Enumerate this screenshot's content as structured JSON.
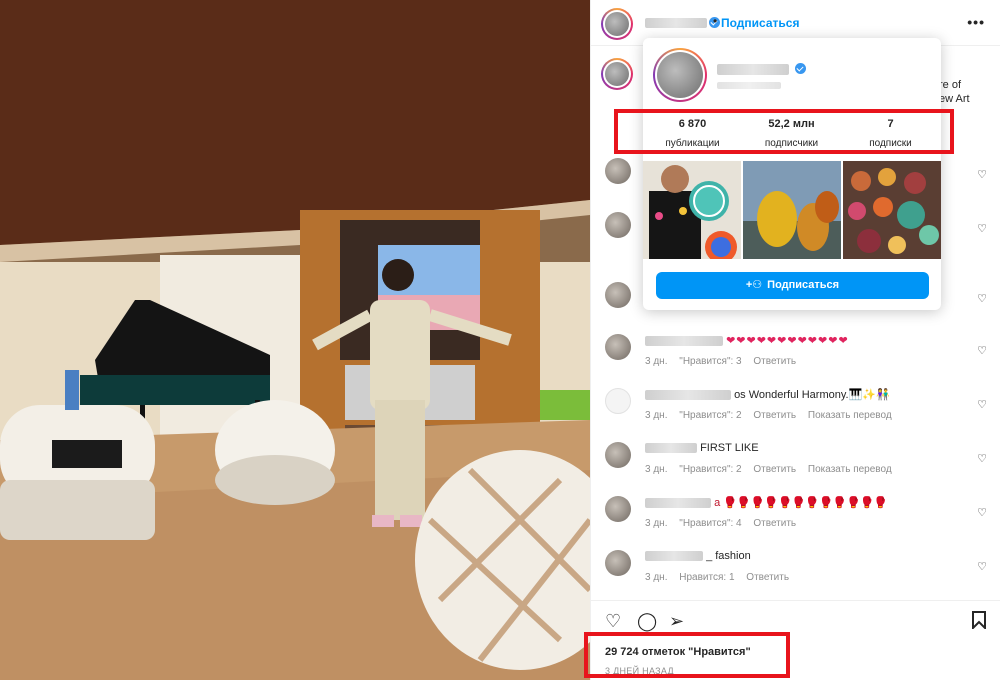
{
  "post": {
    "follow_link": "Подписаться",
    "dot": "•",
    "more": "•••",
    "caption_tail": "re of\new Art"
  },
  "hover_card": {
    "stats": [
      {
        "value": "6 870",
        "label": "публикации"
      },
      {
        "value": "52,2 млн",
        "label": "подписчики"
      },
      {
        "value": "7",
        "label": "подписки"
      }
    ],
    "follow_button": "Подписаться"
  },
  "comments": [
    {
      "text": "",
      "meta": []
    },
    {
      "text": "",
      "meta": []
    },
    {
      "text": "",
      "meta": []
    },
    {
      "text": "❤❤❤❤❤❤❤❤❤❤❤❤",
      "meta": [
        "3 дн.",
        "\"Нравится\": 3",
        "Ответить"
      ]
    },
    {
      "text": "os Wonderful Harmony.🎹✨👫",
      "meta": [
        "3 дн.",
        "\"Нравится\": 2",
        "Ответить",
        "Показать перевод"
      ]
    },
    {
      "text": "FIRST LIKE",
      "meta": [
        "3 дн.",
        "\"Нравится\": 2",
        "Ответить",
        "Показать перевод"
      ]
    },
    {
      "text": "a 🥊🥊🥊🥊🥊🥊🥊🥊🥊🥊🥊🥊",
      "meta": [
        "3 дн.",
        "\"Нравится\": 4",
        "Ответить"
      ]
    },
    {
      "text": "_ fashion",
      "meta": [
        "3 дн.",
        "Нравится: 1",
        "Ответить"
      ]
    }
  ],
  "footer": {
    "likes": "29 724 отметок \"Нравится\"",
    "ago": "3 ДНЕЙ НАЗАД"
  },
  "icons": {
    "heart": "heart-icon",
    "comment": "comment-icon",
    "share": "share-icon",
    "bookmark": "bookmark-icon"
  },
  "colors": {
    "accent": "#0095f6",
    "highlight": "#e8141c"
  }
}
